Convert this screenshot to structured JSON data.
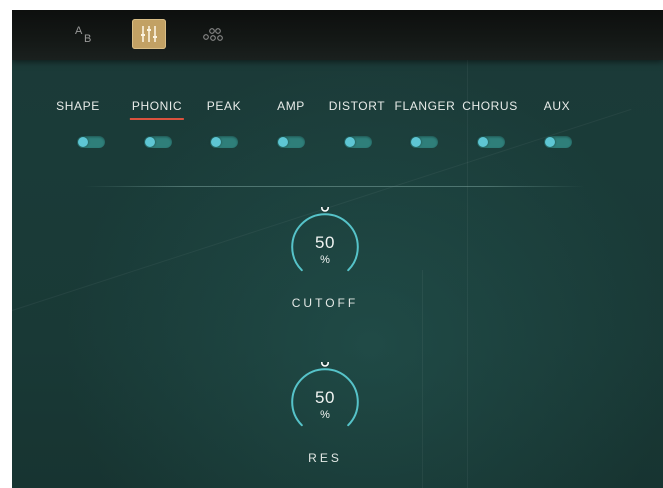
{
  "toolbar": {
    "ab_icon": "ab-compare-icon",
    "mixer_icon": "mixer-sliders-icon",
    "nodes_icon": "nodes-icon",
    "active": "mixer"
  },
  "tabs": [
    {
      "label": "SHAPE"
    },
    {
      "label": "PHONIC",
      "active": true
    },
    {
      "label": "PEAK"
    },
    {
      "label": "AMP"
    },
    {
      "label": "DISTORT"
    },
    {
      "label": "FLANGER"
    },
    {
      "label": "CHORUS"
    },
    {
      "label": "AUX"
    }
  ],
  "toggles": [
    {
      "state": "off"
    },
    {
      "state": "off"
    },
    {
      "state": "off"
    },
    {
      "state": "off"
    },
    {
      "state": "off"
    },
    {
      "state": "off"
    },
    {
      "state": "off"
    },
    {
      "state": "off"
    }
  ],
  "knobs": {
    "cutoff": {
      "value": "50",
      "unit": "%",
      "label": "CUTOFF",
      "level": 0.5
    },
    "res": {
      "value": "50",
      "unit": "%",
      "label": "RES",
      "level": 0.5
    }
  },
  "colors": {
    "background": "#1a3b38",
    "accent_gold": "#c2a164",
    "active_underline": "#d9523e",
    "knob_arc": "#56c3c9",
    "toggle_track": "#2f7f7a",
    "toggle_knob": "#5ec6d4"
  }
}
